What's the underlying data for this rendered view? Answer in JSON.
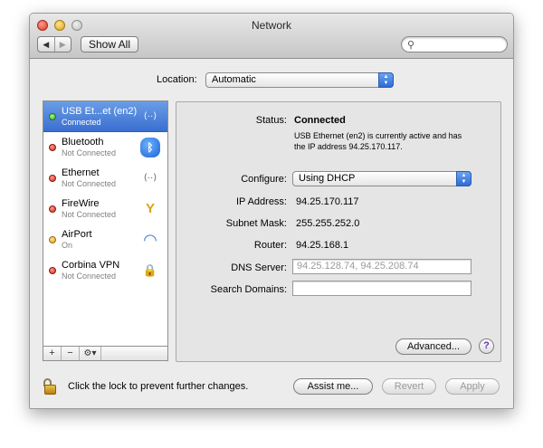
{
  "window": {
    "title": "Network"
  },
  "toolbar": {
    "back": "◀",
    "forward": "▶",
    "show_all": "Show All",
    "search_placeholder": ""
  },
  "location": {
    "label": "Location:",
    "value": "Automatic"
  },
  "services": [
    {
      "name": "USB Et...et (en2)",
      "status": "Connected",
      "dot": "green",
      "icon": "⟨··⟩",
      "selected": true
    },
    {
      "name": "Bluetooth",
      "status": "Not Connected",
      "dot": "red",
      "icon": "ᛒ"
    },
    {
      "name": "Ethernet",
      "status": "Not Connected",
      "dot": "red",
      "icon": "⟨··⟩"
    },
    {
      "name": "FireWire",
      "status": "Not Connected",
      "dot": "red",
      "icon": "Y"
    },
    {
      "name": "AirPort",
      "status": "On",
      "dot": "yellow",
      "icon": "◠"
    },
    {
      "name": "Corbina VPN",
      "status": "Not Connected",
      "dot": "red",
      "icon": "🔒"
    }
  ],
  "sidebar_controls": {
    "add": "+",
    "remove": "−",
    "gear": "⚙▾"
  },
  "detail": {
    "status_label": "Status:",
    "status_value": "Connected",
    "status_description": "USB Ethernet (en2) is currently active and has the IP address 94.25.170.117.",
    "configure_label": "Configure:",
    "configure_value": "Using DHCP",
    "ip_label": "IP Address:",
    "ip_value": "94.25.170.117",
    "subnet_label": "Subnet Mask:",
    "subnet_value": "255.255.252.0",
    "router_label": "Router:",
    "router_value": "94.25.168.1",
    "dns_label": "DNS Server:",
    "dns_value": "94.25.128.74, 94.25.208.74",
    "search_domains_label": "Search Domains:",
    "search_domains_value": "",
    "advanced_button": "Advanced...",
    "help_button": "?"
  },
  "footer": {
    "lock_text": "Click the lock to prevent further changes.",
    "assist_button": "Assist me...",
    "revert_button": "Revert",
    "apply_button": "Apply"
  },
  "colors": {
    "selection": "#3a6fd0",
    "connected": "#2ea31c",
    "not_connected": "#c92c1c",
    "on": "#e0a014"
  }
}
